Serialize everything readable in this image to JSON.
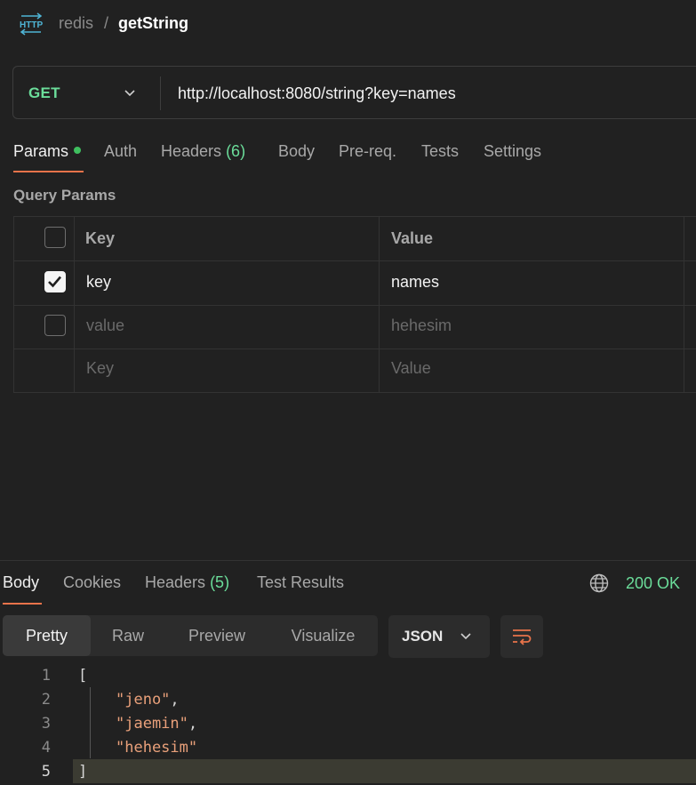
{
  "breadcrumb": {
    "collection": "redis",
    "separator": "/",
    "request": "getString"
  },
  "request": {
    "method": "GET",
    "url": "http://localhost:8080/string?key=names"
  },
  "request_tabs": [
    {
      "label": "Params",
      "active": true,
      "indicator_dot": true
    },
    {
      "label": "Auth"
    },
    {
      "label": "Headers",
      "count": "(6)"
    },
    {
      "label": "Body"
    },
    {
      "label": "Pre-req."
    },
    {
      "label": "Tests"
    },
    {
      "label": "Settings"
    }
  ],
  "query_params": {
    "title": "Query Params",
    "columns": {
      "key": "Key",
      "value": "Value"
    },
    "rows": [
      {
        "checked": true,
        "key": "key",
        "value": "names"
      },
      {
        "checked": false,
        "key": "value",
        "value": "hehesim",
        "muted": true
      }
    ],
    "new_row": {
      "key_placeholder": "Key",
      "value_placeholder": "Value"
    }
  },
  "response_tabs": [
    {
      "label": "Body",
      "active": true
    },
    {
      "label": "Cookies"
    },
    {
      "label": "Headers",
      "count": "(5)"
    },
    {
      "label": "Test Results"
    }
  ],
  "response_status": "200 OK",
  "view_modes": [
    "Pretty",
    "Raw",
    "Preview",
    "Visualize"
  ],
  "active_view_mode": "Pretty",
  "format": "JSON",
  "code_lines": [
    {
      "n": "1",
      "text": "["
    },
    {
      "n": "2",
      "text": "\"jeno\"",
      "suffix": ","
    },
    {
      "n": "3",
      "text": "\"jaemin\"",
      "suffix": ","
    },
    {
      "n": "4",
      "text": "\"hehesim\""
    },
    {
      "n": "5",
      "text": "]"
    }
  ],
  "colors": {
    "accent": "#e8734a",
    "method_get": "#6bdd9a",
    "status_ok": "#6bdd9a",
    "string_value": "#e9a07a"
  }
}
